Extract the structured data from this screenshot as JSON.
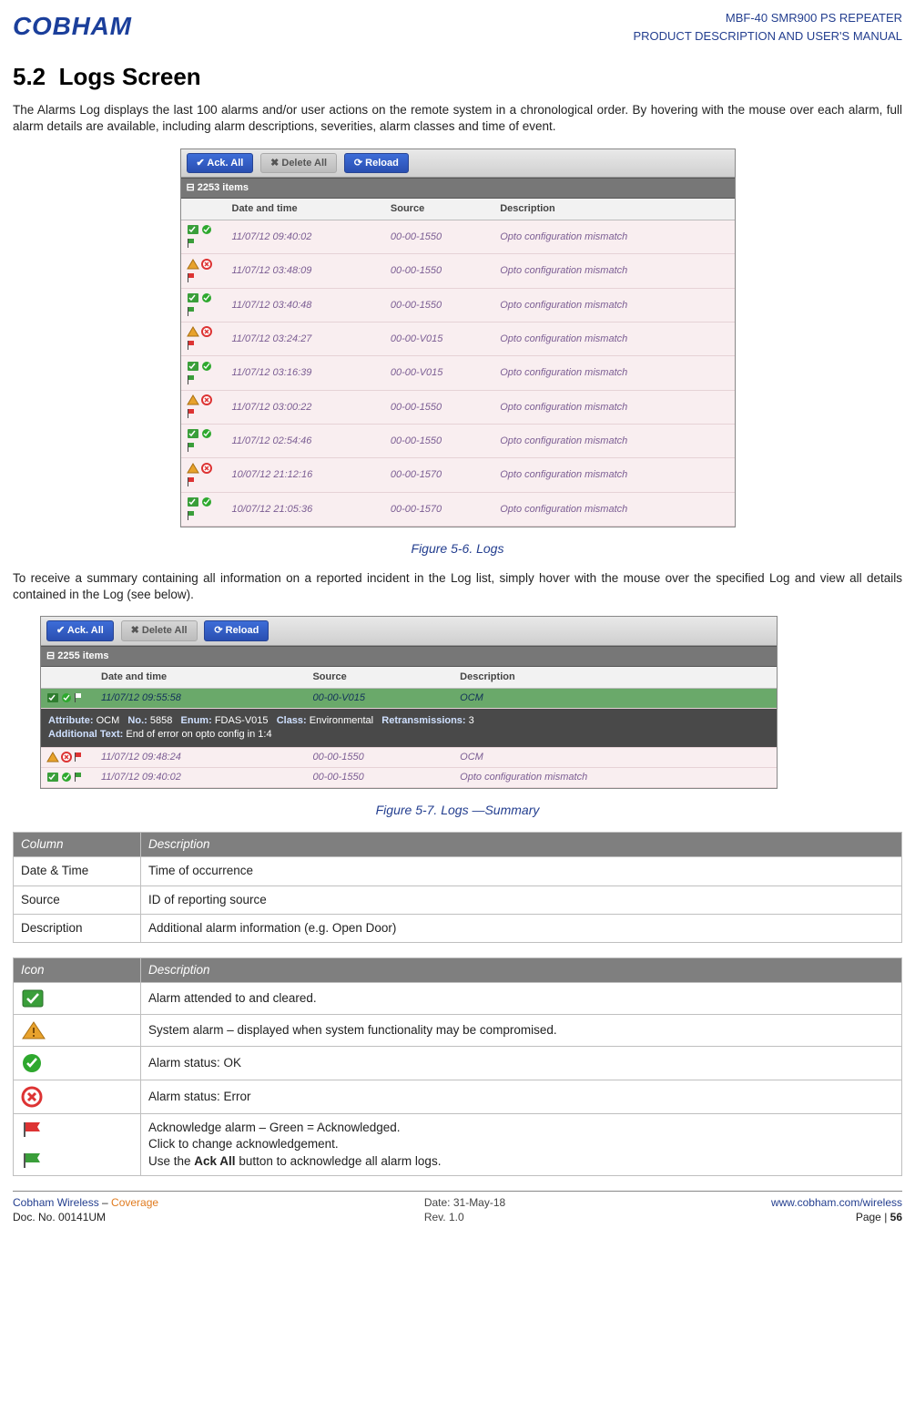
{
  "header": {
    "logo_text": "COBHAM",
    "title_line1": "MBF-40 SMR900 PS REPEATER",
    "title_line2": "PRODUCT DESCRIPTION AND USER'S MANUAL"
  },
  "section": {
    "heading_number": "5.2",
    "heading_text": "Logs Screen",
    "para1": "The Alarms Log displays the last 100 alarms and/or user actions on the remote system in a chronological order. By hovering with the mouse over each alarm, full alarm details are available, including alarm descriptions, severities, alarm classes and time of event."
  },
  "screenshot1": {
    "btn_ack": "Ack. All",
    "btn_delete": "Delete All",
    "btn_reload": "Reload",
    "item_count": "2253 items",
    "columns": {
      "c1": "Date and time",
      "c2": "Source",
      "c3": "Description"
    },
    "rows": [
      {
        "icons": "green",
        "dt": "11/07/12 09:40:02",
        "src": "00-00-1550",
        "desc": "Opto configuration mismatch"
      },
      {
        "icons": "yellow",
        "dt": "11/07/12 03:48:09",
        "src": "00-00-1550",
        "desc": "Opto configuration mismatch"
      },
      {
        "icons": "green",
        "dt": "11/07/12 03:40:48",
        "src": "00-00-1550",
        "desc": "Opto configuration mismatch"
      },
      {
        "icons": "yellow",
        "dt": "11/07/12 03:24:27",
        "src": "00-00-V015",
        "desc": "Opto configuration mismatch"
      },
      {
        "icons": "green",
        "dt": "11/07/12 03:16:39",
        "src": "00-00-V015",
        "desc": "Opto configuration mismatch"
      },
      {
        "icons": "yellow",
        "dt": "11/07/12 03:00:22",
        "src": "00-00-1550",
        "desc": "Opto configuration mismatch"
      },
      {
        "icons": "green",
        "dt": "11/07/12 02:54:46",
        "src": "00-00-1550",
        "desc": "Opto configuration mismatch"
      },
      {
        "icons": "yellow",
        "dt": "10/07/12 21:12:16",
        "src": "00-00-1570",
        "desc": "Opto configuration mismatch"
      },
      {
        "icons": "green",
        "dt": "10/07/12 21:05:36",
        "src": "00-00-1570",
        "desc": "Opto configuration mismatch"
      }
    ]
  },
  "figure1_caption": "Figure 5-6.  Logs",
  "section2": {
    "para": "To receive a summary containing all information on a reported incident in the Log list, simply hover with the mouse over the specified Log and view all details contained in the Log (see below)."
  },
  "screenshot2": {
    "btn_ack": "Ack. All",
    "btn_delete": "Delete All",
    "btn_reload": "Reload",
    "item_count": "2255 items",
    "columns": {
      "c1": "Date and time",
      "c2": "Source",
      "c3": "Description"
    },
    "row_hover": {
      "dt": "11/07/12 09:55:58",
      "src": "00-00-V015",
      "desc": "OCM"
    },
    "detail": {
      "line1_labels": {
        "attr": "Attribute:",
        "no": "No.:",
        "enum": "Enum:",
        "class": "Class:",
        "retr": "Retransmissions:"
      },
      "attr_val": "OCM",
      "no_val": "5858",
      "enum_val": "FDAS-V015",
      "class_val": "Environmental",
      "retr_val": "3",
      "line2_label": "Additional Text:",
      "line2_val": "End of error on opto config in 1:4"
    },
    "row2": {
      "dt": "11/07/12 09:48:24",
      "src": "00-00-1550",
      "desc": "OCM"
    },
    "row3": {
      "dt": "11/07/12 09:40:02",
      "src": "00-00-1550",
      "desc": "Opto configuration mismatch"
    }
  },
  "figure2_caption": "Figure 5-7. Logs —Summary",
  "table_columns": {
    "header_col": "Column",
    "header_desc": "Description",
    "rows": [
      {
        "col": "Date & Time",
        "desc": "Time of occurrence"
      },
      {
        "col": "Source",
        "desc": "ID of reporting source"
      },
      {
        "col": "Description",
        "desc": "Additional alarm information (e.g. Open Door)"
      }
    ]
  },
  "table_icons": {
    "header_icon": "Icon",
    "header_desc": "Description",
    "rows": [
      {
        "icon": "attended-cleared-icon",
        "desc": "Alarm attended to and cleared."
      },
      {
        "icon": "system-alarm-icon",
        "desc": "System alarm – displayed when system functionality may be compromised."
      },
      {
        "icon": "status-ok-icon",
        "desc": "Alarm status: OK"
      },
      {
        "icon": "status-error-icon",
        "desc": "Alarm status: Error"
      },
      {
        "icon": "flag-pair-icon",
        "desc_line1": "Acknowledge alarm – Green = Acknowledged.",
        "desc_line2": "Click to change acknowledgement.",
        "desc_line3_prefix": "Use the ",
        "desc_line3_bold": "Ack All",
        "desc_line3_suffix": " button to acknowledge all alarm logs."
      }
    ]
  },
  "footer": {
    "left_brand": "Cobham Wireless",
    "left_dash": " – ",
    "left_cov": "Coverage",
    "left_doc": "Doc. No. 00141UM",
    "center_date": "Date: 31-May-18",
    "center_rev": "Rev. 1.0",
    "link_text": "www.cobham.com/wireless",
    "page_label": "Page | ",
    "page_num": "56"
  }
}
